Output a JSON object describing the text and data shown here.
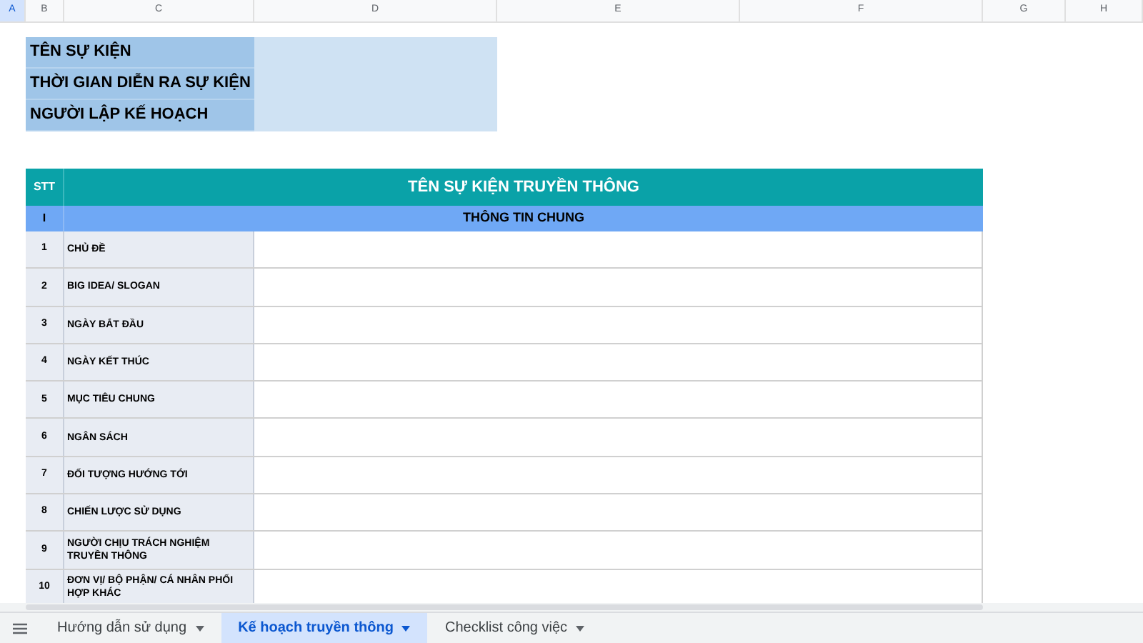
{
  "column_headers": [
    {
      "label": "A",
      "selected": true
    },
    {
      "label": "B",
      "selected": false
    },
    {
      "label": "C",
      "selected": false
    },
    {
      "label": "D",
      "selected": false
    },
    {
      "label": "E",
      "selected": false
    },
    {
      "label": "F",
      "selected": false
    },
    {
      "label": "G",
      "selected": false
    },
    {
      "label": "H",
      "selected": false
    }
  ],
  "info_block": [
    {
      "label": "TÊN SỰ KIỆN"
    },
    {
      "label": "THỜI GIAN DIỄN RA SỰ KIỆN"
    },
    {
      "label": "NGƯỜI LẬP KẾ HOẠCH"
    }
  ],
  "plan_table": {
    "header": {
      "number": "STT",
      "title": "TÊN SỰ KIỆN TRUYỀN THÔNG"
    },
    "section": {
      "number": "I",
      "title": "THÔNG TIN CHUNG"
    },
    "rows": [
      {
        "number": "1",
        "label": "CHỦ ĐỀ"
      },
      {
        "number": "2",
        "label": "BIG IDEA/ SLOGAN"
      },
      {
        "number": "3",
        "label": "NGÀY BẮT ĐẦU"
      },
      {
        "number": "4",
        "label": "NGÀY KẾT THÚC"
      },
      {
        "number": "5",
        "label": "MỤC TIÊU CHUNG"
      },
      {
        "number": "6",
        "label": "NGÂN SÁCH"
      },
      {
        "number": "7",
        "label": "ĐỐI TƯỢNG HƯỚNG TỚI"
      },
      {
        "number": "8",
        "label": "CHIẾN LƯỢC SỬ DỤNG"
      },
      {
        "number": "9",
        "label": "NGƯỜI CHỊU TRÁCH NGHIỆM TRUYỀN THÔNG"
      },
      {
        "number": "10",
        "label": "ĐƠN VỊ/ BỘ PHẬN/ CÁ NHÂN PHỐI HỢP KHÁC"
      }
    ]
  },
  "sheet_tabs": [
    {
      "label": "Hướng dẫn sử dụng",
      "selected": false
    },
    {
      "label": "Kế hoạch truyền thông",
      "selected": true
    },
    {
      "label": "Checklist công việc",
      "selected": false
    }
  ]
}
